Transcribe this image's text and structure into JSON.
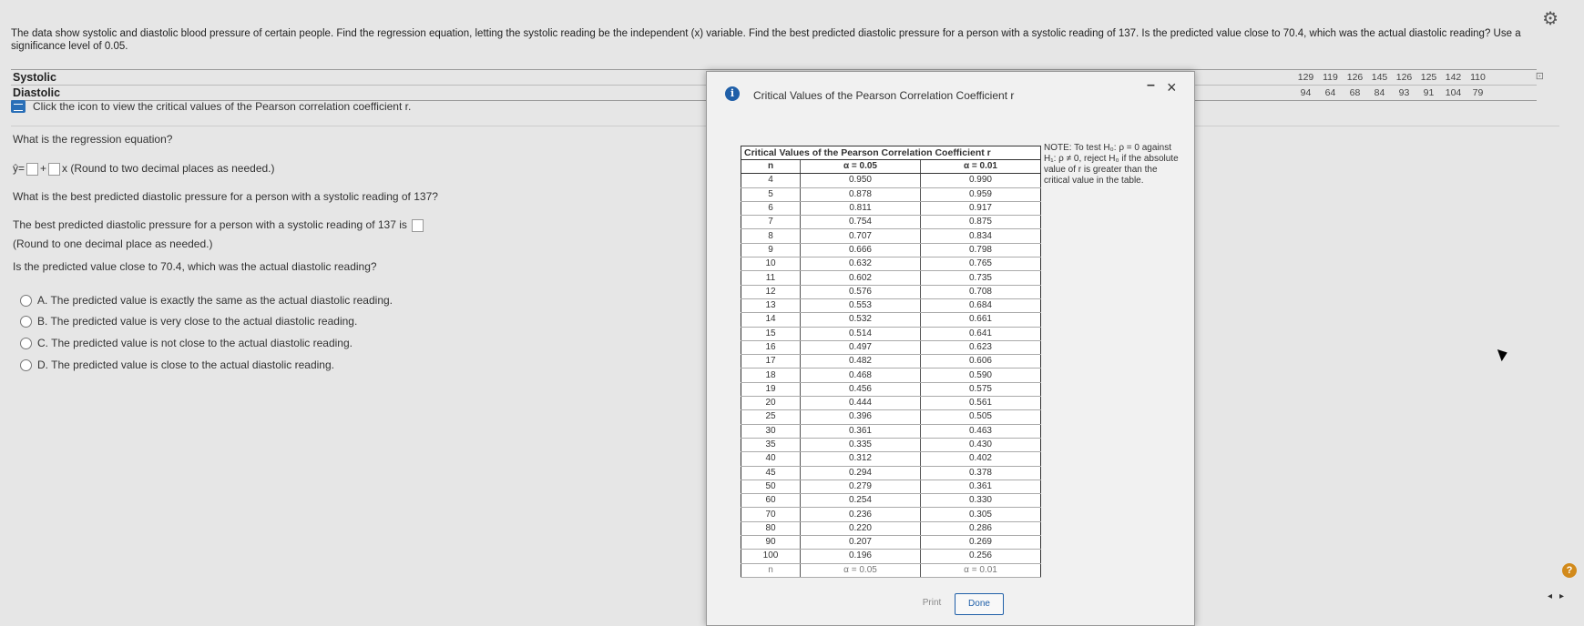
{
  "question": {
    "text": "The data show systolic and diastolic blood pressure of certain people. Find the regression equation, letting the systolic reading be the independent (x) variable. Find the best predicted diastolic pressure for a person with a systolic reading of 137. Is the predicted value close to 70.4, which was the actual diastolic reading? Use a significance level of 0.05."
  },
  "datatable": {
    "row1_label": "Systolic",
    "row2_label": "Diastolic",
    "systolic": [
      "129",
      "119",
      "126",
      "145",
      "126",
      "125",
      "142",
      "110"
    ],
    "diastolic": [
      "94",
      "64",
      "68",
      "84",
      "93",
      "91",
      "104",
      "79"
    ]
  },
  "help": {
    "text": "Click the icon to view the critical values of the Pearson correlation coefficient r."
  },
  "q1": {
    "title": "What is the regression equation?",
    "yhat": "ŷ",
    "eq": "=",
    "plus": "+",
    "x": "x",
    "hint": "(Round to two decimal places as needed.)"
  },
  "q2": {
    "title": "What is the best predicted diastolic pressure for a person with a systolic reading of 137?",
    "answer_prefix": "The best predicted diastolic pressure for a person with a systolic reading of 137 is",
    "hint": "(Round to one decimal place as needed.)"
  },
  "q3": {
    "title": "Is the predicted value close to 70.4, which was the actual diastolic reading?",
    "options": [
      "A.  The predicted value is exactly the same as the actual diastolic reading.",
      "B.  The predicted value is very close to the actual diastolic reading.",
      "C.  The predicted value is not close to the actual diastolic reading.",
      "D.  The predicted value is close to the actual diastolic reading."
    ]
  },
  "modal": {
    "info_glyph": "i",
    "title": "Critical Values of the Pearson Correlation Coefficient r",
    "minimize": "–",
    "close": "×",
    "table_title": "Critical Values of the Pearson Correlation Coefficient r",
    "col_n": "n",
    "col_a05": "α = 0.05",
    "col_a01": "α = 0.01",
    "rows": [
      [
        "4",
        "0.950",
        "0.990"
      ],
      [
        "5",
        "0.878",
        "0.959"
      ],
      [
        "6",
        "0.811",
        "0.917"
      ],
      [
        "7",
        "0.754",
        "0.875"
      ],
      [
        "8",
        "0.707",
        "0.834"
      ],
      [
        "9",
        "0.666",
        "0.798"
      ],
      [
        "10",
        "0.632",
        "0.765"
      ],
      [
        "11",
        "0.602",
        "0.735"
      ],
      [
        "12",
        "0.576",
        "0.708"
      ],
      [
        "13",
        "0.553",
        "0.684"
      ],
      [
        "14",
        "0.532",
        "0.661"
      ],
      [
        "15",
        "0.514",
        "0.641"
      ],
      [
        "16",
        "0.497",
        "0.623"
      ],
      [
        "17",
        "0.482",
        "0.606"
      ],
      [
        "18",
        "0.468",
        "0.590"
      ],
      [
        "19",
        "0.456",
        "0.575"
      ],
      [
        "20",
        "0.444",
        "0.561"
      ],
      [
        "25",
        "0.396",
        "0.505"
      ],
      [
        "30",
        "0.361",
        "0.463"
      ],
      [
        "35",
        "0.335",
        "0.430"
      ],
      [
        "40",
        "0.312",
        "0.402"
      ],
      [
        "45",
        "0.294",
        "0.378"
      ],
      [
        "50",
        "0.279",
        "0.361"
      ],
      [
        "60",
        "0.254",
        "0.330"
      ],
      [
        "70",
        "0.236",
        "0.305"
      ],
      [
        "80",
        "0.220",
        "0.286"
      ],
      [
        "90",
        "0.207",
        "0.269"
      ],
      [
        "100",
        "0.196",
        "0.256"
      ]
    ],
    "foot_n": "n",
    "foot_a05": "α = 0.05",
    "foot_a01": "α = 0.01",
    "note": "NOTE: To test H₀: ρ = 0 against H₁: ρ ≠ 0, reject H₀ if the absolute value of r is greater than the critical value in the table.",
    "print_label": "Print",
    "done_label": "Done"
  },
  "icons": {
    "settings": "gear-icon",
    "help": "question-icon",
    "info": "info-icon"
  },
  "colors": {
    "accent": "#1f5fa8",
    "help_badge": "#d28a1b"
  }
}
